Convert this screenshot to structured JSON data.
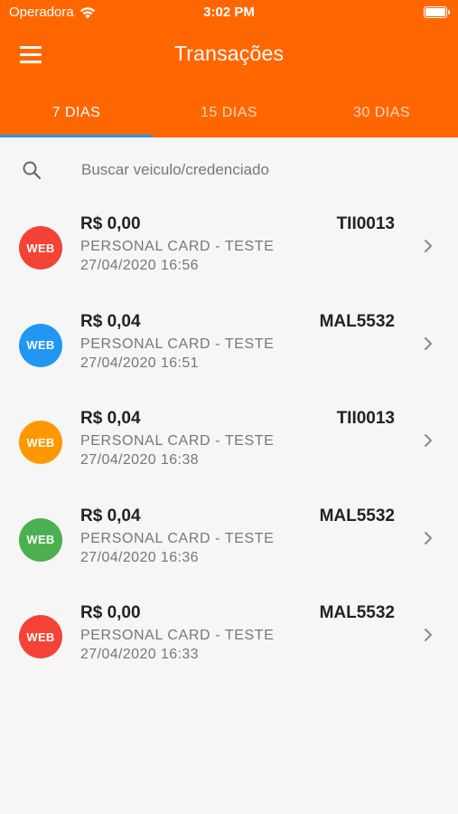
{
  "status_bar": {
    "carrier": "Operadora",
    "time": "3:02 PM"
  },
  "header": {
    "title": "Transações"
  },
  "tabs": [
    {
      "label": "7 DIAS",
      "active": true
    },
    {
      "label": "15 DIAS",
      "active": false
    },
    {
      "label": "30 DIAS",
      "active": false
    }
  ],
  "search": {
    "placeholder": "Buscar veiculo/credenciado",
    "value": ""
  },
  "transactions": [
    {
      "badge": "WEB",
      "color": "#f44336",
      "amount": "R$ 0,00",
      "plate": "TII0013",
      "merchant": "PERSONAL CARD - TESTE",
      "datetime": "27/04/2020 16:56"
    },
    {
      "badge": "WEB",
      "color": "#2196f3",
      "amount": "R$ 0,04",
      "plate": "MAL5532",
      "merchant": "PERSONAL CARD - TESTE",
      "datetime": "27/04/2020 16:51"
    },
    {
      "badge": "WEB",
      "color": "#ff9800",
      "amount": "R$ 0,04",
      "plate": "TII0013",
      "merchant": "PERSONAL CARD - TESTE",
      "datetime": "27/04/2020 16:38"
    },
    {
      "badge": "WEB",
      "color": "#4caf50",
      "amount": "R$ 0,04",
      "plate": "MAL5532",
      "merchant": "PERSONAL CARD - TESTE",
      "datetime": "27/04/2020 16:36"
    },
    {
      "badge": "WEB",
      "color": "#f44336",
      "amount": "R$ 0,00",
      "plate": "MAL5532",
      "merchant": "PERSONAL CARD - TESTE",
      "datetime": "27/04/2020 16:33"
    }
  ],
  "icons": {
    "menu": "menu-icon",
    "search": "search-icon",
    "chevron": "chevron-right-icon",
    "wifi": "wifi-icon",
    "battery": "battery-icon"
  },
  "colors": {
    "header": "#ff6600",
    "tab_indicator": "#2196f3"
  }
}
